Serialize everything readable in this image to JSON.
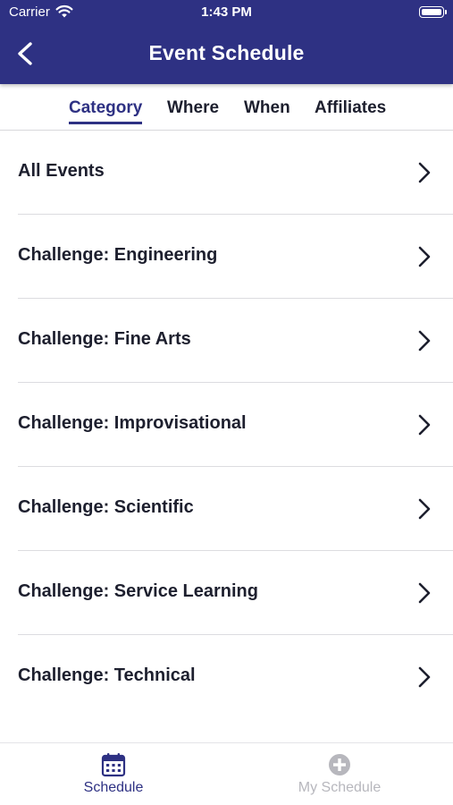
{
  "status_bar": {
    "carrier": "Carrier",
    "time": "1:43 PM"
  },
  "header": {
    "title": "Event Schedule",
    "back_icon": "chevron-left-icon"
  },
  "tabs": [
    {
      "label": "Category",
      "active": true
    },
    {
      "label": "Where",
      "active": false
    },
    {
      "label": "When",
      "active": false
    },
    {
      "label": "Affiliates",
      "active": false
    }
  ],
  "list": {
    "items": [
      {
        "label": "All Events"
      },
      {
        "label": "Challenge: Engineering"
      },
      {
        "label": "Challenge: Fine Arts"
      },
      {
        "label": "Challenge: Improvisational"
      },
      {
        "label": "Challenge: Scientific"
      },
      {
        "label": "Challenge: Service Learning"
      },
      {
        "label": "Challenge: Technical"
      }
    ]
  },
  "tab_bar": {
    "items": [
      {
        "label": "Schedule",
        "icon": "calendar-icon",
        "active": true
      },
      {
        "label": "My Schedule",
        "icon": "plus-circle-icon",
        "active": false
      }
    ]
  },
  "colors": {
    "primary": "#2e3183",
    "text": "#1d1f2e",
    "inactive": "#b7b7bd"
  }
}
